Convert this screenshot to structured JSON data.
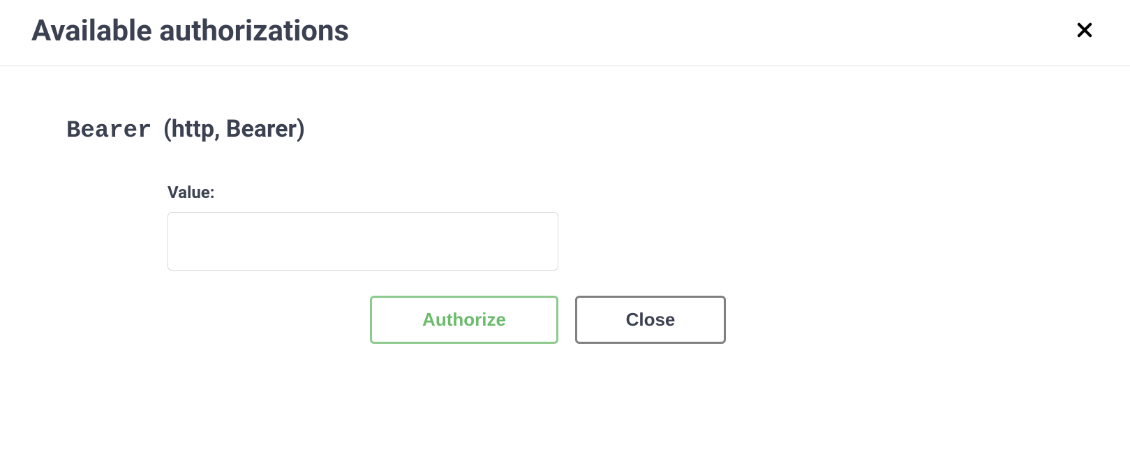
{
  "modal": {
    "title": "Available authorizations"
  },
  "auth": {
    "scheme_name": "Bearer",
    "scheme_type": "(http, Bearer)",
    "value_label": "Value:",
    "value": ""
  },
  "buttons": {
    "authorize": "Authorize",
    "close": "Close"
  }
}
